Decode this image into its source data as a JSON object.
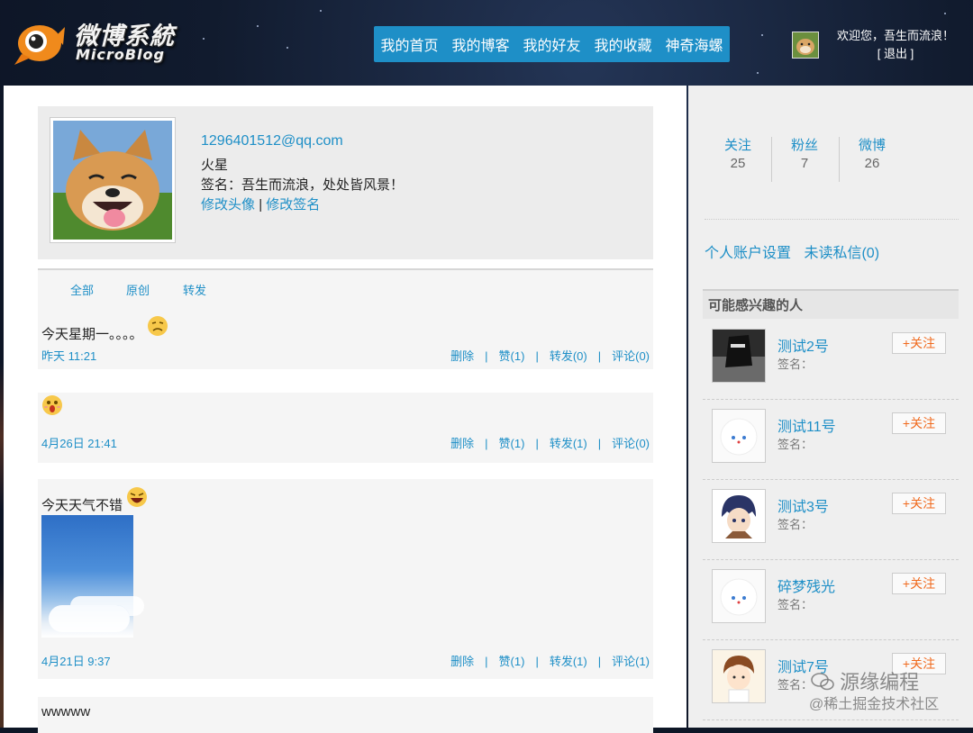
{
  "app": {
    "logo_title": "微博系統",
    "logo_sub": "MicroBlog"
  },
  "nav": {
    "items": [
      "我的首页",
      "我的博客",
      "我的好友",
      "我的收藏",
      "神奇海螺"
    ]
  },
  "user": {
    "welcome": "欢迎您，吾生而流浪！",
    "logout": "[ 退出 ]"
  },
  "profile": {
    "email": "1296401512@qq.com",
    "city": "火星",
    "signature": "签名：吾生而流浪，处处皆风景！",
    "edit_avatar": "修改头像",
    "sep": "|",
    "edit_sign": "修改签名"
  },
  "tabs": [
    "全部",
    "原创",
    "转发"
  ],
  "posts": [
    {
      "text": "今天星期一。。。。",
      "time": "昨天 11:21",
      "delete": "删除",
      "like": "赞(1)",
      "forward": "转发(0)",
      "comment": "评论(0)"
    },
    {
      "text": "",
      "time": "4月26日 21:41",
      "delete": "删除",
      "like": "赞(1)",
      "forward": "转发(1)",
      "comment": "评论(0)"
    },
    {
      "text": "今天天气不错",
      "time": "4月21日 9:37",
      "delete": "删除",
      "like": "赞(1)",
      "forward": "转发(1)",
      "comment": "评论(1)"
    },
    {
      "text": "wwwww"
    }
  ],
  "stats": {
    "follow_label": "关注",
    "follow_num": "25",
    "fans_label": "粉丝",
    "fans_num": "7",
    "weibo_label": "微博",
    "weibo_num": "26"
  },
  "side_links": {
    "account": "个人账户设置",
    "messages": "未读私信(0)"
  },
  "suggest": {
    "title": "可能感兴趣的人",
    "people": [
      {
        "name": "测试2号",
        "sign": "签名：",
        "follow": "+关注"
      },
      {
        "name": "测试11号",
        "sign": "签名：",
        "follow": "+关注"
      },
      {
        "name": "测试3号",
        "sign": "签名：",
        "follow": "+关注"
      },
      {
        "name": "碎梦残光",
        "sign": "签名：",
        "follow": "+关注"
      },
      {
        "name": "测试7号",
        "sign": "签名：",
        "follow": "+关注"
      }
    ]
  },
  "watermark": {
    "line1": "源缘编程",
    "line2": "@稀土掘金技术社区"
  },
  "colors": {
    "accent": "#1e8fc7",
    "follow": "#f06a1e"
  }
}
